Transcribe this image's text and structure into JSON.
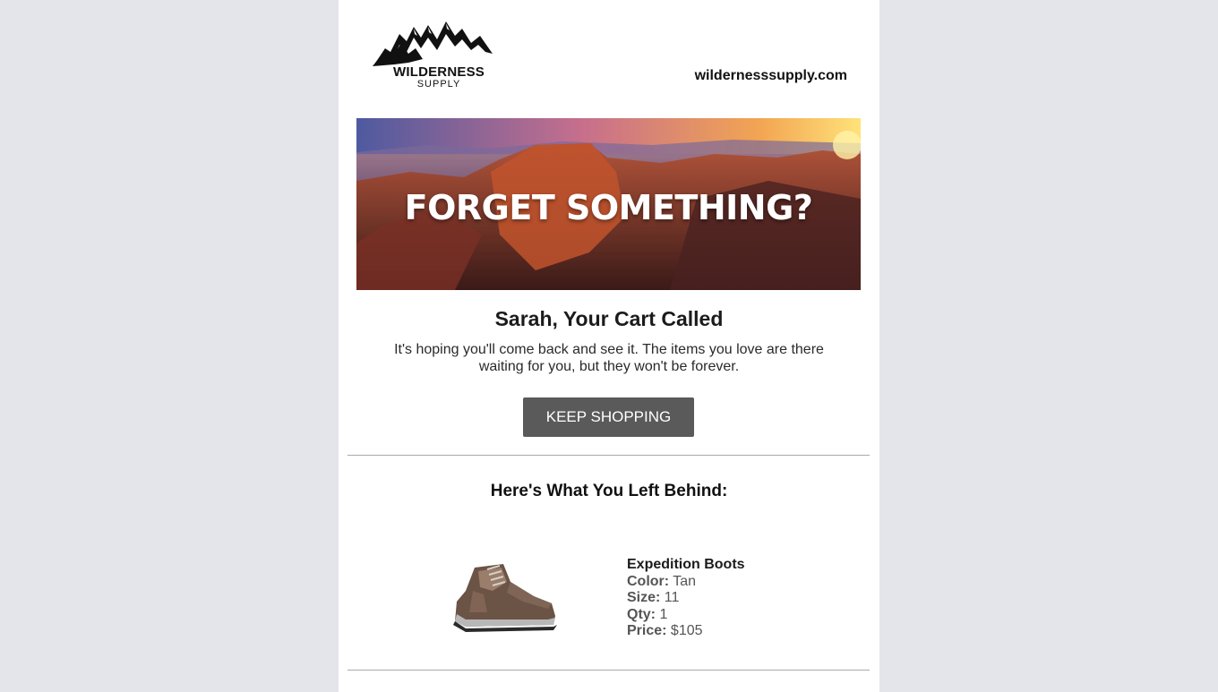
{
  "brand": {
    "name": "WILDERNESS",
    "sub": "SUPPLY",
    "website": "wildernesssupply.com"
  },
  "hero": {
    "headline": "FORGET SOMETHING?"
  },
  "message": {
    "title": "Sarah, Your Cart Called",
    "body": "It's hoping you'll come back and see it. The items you love are there waiting for you, but they won't be forever."
  },
  "cta": {
    "label": "KEEP SHOPPING"
  },
  "cart": {
    "section_title": "Here's What You Left Behind:",
    "items": [
      {
        "name": "Expedition Boots",
        "icon": "hiking-boot-icon",
        "specs": [
          {
            "label": "Color:",
            "value": "Tan"
          },
          {
            "label": "Size:",
            "value": "11"
          },
          {
            "label": "Qty:",
            "value": "1"
          },
          {
            "label": "Price:",
            "value": "$105"
          }
        ]
      }
    ]
  },
  "colors": {
    "page_background": "#e3e5ea",
    "email_background": "#ffffff",
    "button": "#5a5a5a",
    "divider": "#a9a9a9"
  }
}
